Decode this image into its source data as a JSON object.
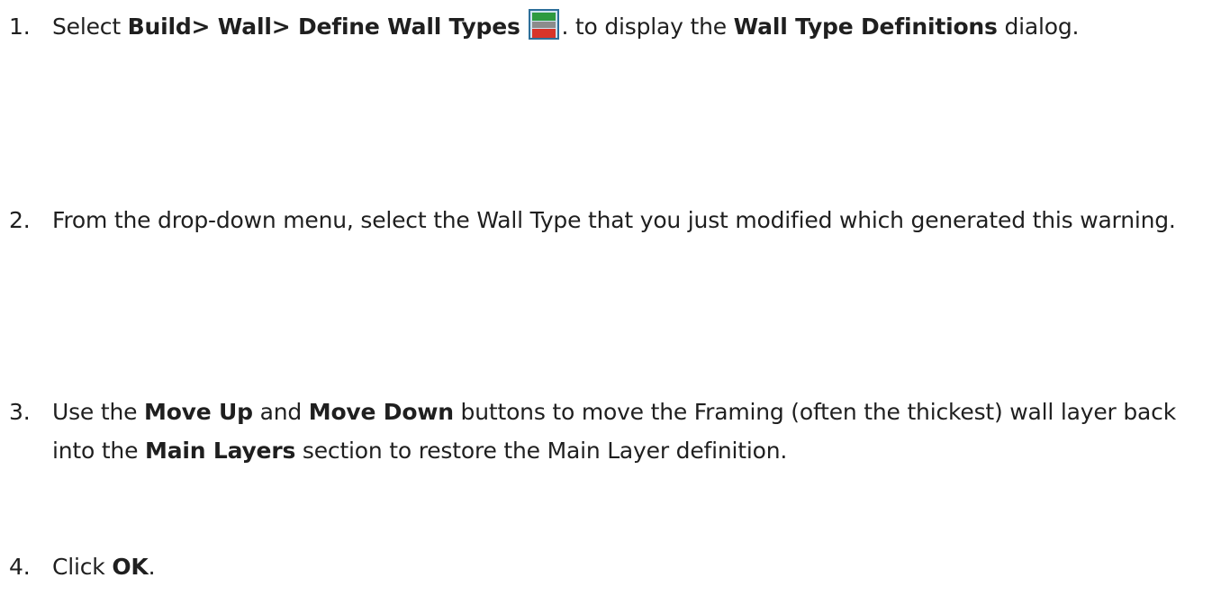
{
  "steps": [
    {
      "number": "1.",
      "select_label": "Select ",
      "menu_path": "Build> Wall> Define Wall Types",
      "icon": "define-wall-types-icon",
      "after_icon": ". to display the ",
      "dialog_name": "Wall Type Definitions",
      "tail": " dialog."
    },
    {
      "number": "2.",
      "text": "From the drop-down menu, select the Wall Type that you just modified which generated this warning."
    },
    {
      "number": "3.",
      "t1": "Use the ",
      "b1": "Move Up",
      "t2": " and ",
      "b2": "Move Down",
      "t3": " buttons to move the Framing (often the thickest) wall layer back into the ",
      "b3": "Main Layers",
      "t4": " section to restore the Main Layer definition."
    },
    {
      "number": "4.",
      "t1": "Click ",
      "b1": "OK",
      "t2": "."
    }
  ],
  "colors": {
    "icon_top": "#2e9a3f",
    "icon_middle": "#8c8c8c",
    "icon_bottom": "#d8352a",
    "icon_border": "#2d6f9a"
  }
}
